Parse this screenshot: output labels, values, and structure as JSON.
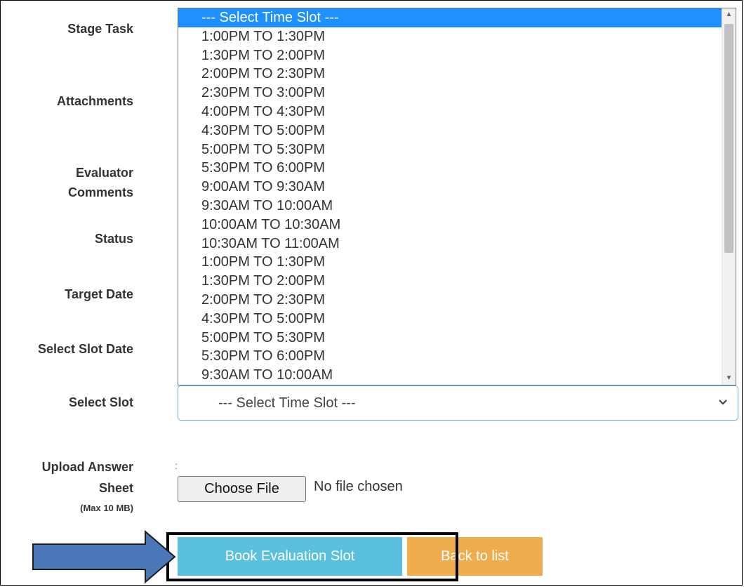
{
  "labels": {
    "stage_task": "Stage Task",
    "attachments": "Attachments",
    "evaluator_line1": "Evaluator",
    "evaluator_line2": "Comments",
    "status": "Status",
    "target_date": "Target Date",
    "select_slot_date": "Select Slot Date",
    "select_slot": "Select Slot",
    "upload_line1": "Upload Answer",
    "upload_line2": "Sheet",
    "upload_line3": "(Max 10 MB)"
  },
  "dropdown": {
    "options": [
      "--- Select Time Slot ---",
      "1:00PM TO 1:30PM",
      "1:30PM TO 2:00PM",
      "2:00PM TO 2:30PM",
      "2:30PM TO 3:00PM",
      "4:00PM TO 4:30PM",
      "4:30PM TO 5:00PM",
      "5:00PM TO 5:30PM",
      "5:30PM TO 6:00PM",
      "9:00AM TO 9:30AM",
      "9:30AM TO 10:00AM",
      "10:00AM TO 10:30AM",
      "10:30AM TO 11:00AM",
      "1:00PM TO 1:30PM",
      "1:30PM TO 2:00PM",
      "2:00PM TO 2:30PM",
      "4:30PM TO 5:00PM",
      "5:00PM TO 5:30PM",
      "5:30PM TO 6:00PM",
      "9:30AM TO 10:00AM"
    ],
    "highlighted_index": 0
  },
  "select_slot": {
    "value": "--- Select Time Slot ---"
  },
  "upload": {
    "colon": ":",
    "choose_button": "Choose File",
    "status": "No file chosen"
  },
  "buttons": {
    "book": "Book Evaluation Slot",
    "back": "Back to list"
  },
  "colors": {
    "highlight": "#1e90ff",
    "book_button": "#5bc0de",
    "back_button": "#f0ad4e",
    "arrow_fill": "#4a78b8"
  }
}
